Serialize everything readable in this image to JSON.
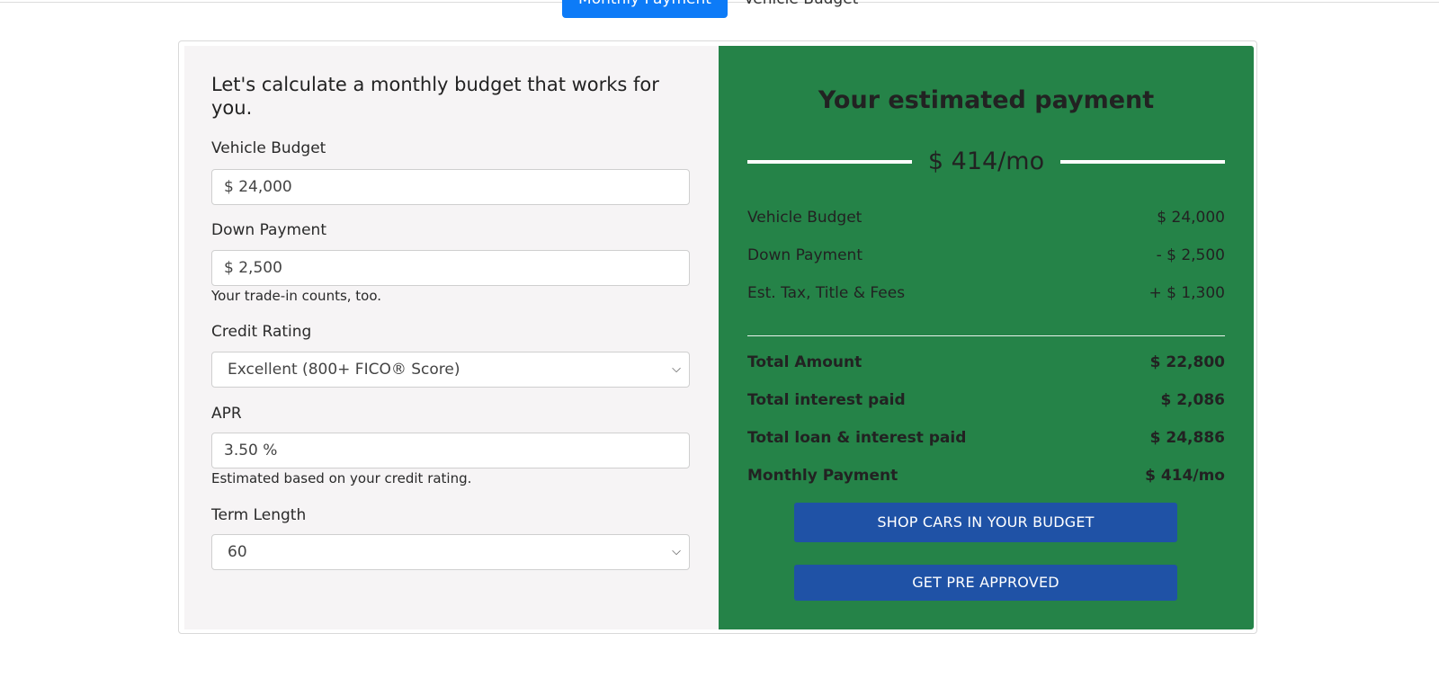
{
  "tabs": {
    "active": "Monthly Payment",
    "inactive": "Vehicle Budget"
  },
  "form": {
    "heading": "Let's calculate a monthly budget that works for you.",
    "vehicle_budget": {
      "label": "Vehicle Budget",
      "value": "$ 24,000"
    },
    "down_payment": {
      "label": "Down Payment",
      "value": "$ 2,500",
      "help": "Your trade-in counts, too."
    },
    "credit_rating": {
      "label": "Credit Rating",
      "value": "Excellent (800+ FICO® Score)"
    },
    "apr": {
      "label": "APR",
      "value": "3.50 %",
      "help": "Estimated based on your credit rating."
    },
    "term_length": {
      "label": "Term Length",
      "value": "60"
    }
  },
  "summary": {
    "title": "Your estimated payment",
    "amount": "$ 414/mo",
    "rows": [
      {
        "label": "Vehicle Budget",
        "value": "$ 24,000"
      },
      {
        "label": "Down Payment",
        "value": "- $ 2,500"
      },
      {
        "label": "Est. Tax, Title & Fees",
        "value": "+ $ 1,300"
      }
    ],
    "totals": [
      {
        "label": "Total Amount",
        "value": "$ 22,800"
      },
      {
        "label": "Total interest paid",
        "value": "$ 2,086"
      },
      {
        "label": "Total loan & interest paid",
        "value": "$ 24,886"
      },
      {
        "label": "Monthly Payment",
        "value": "$ 414/mo"
      }
    ],
    "shop_button": "SHOP CARS IN YOUR BUDGET",
    "preapprove_button": "GET PRE APPROVED"
  },
  "colors": {
    "accent_blue": "#0d7bf7",
    "panel_green": "#258348",
    "button_blue": "#1f52a6",
    "left_panel": "#f6f4f5"
  },
  "icons": {
    "select_chevron": "chevron-down-icon"
  }
}
